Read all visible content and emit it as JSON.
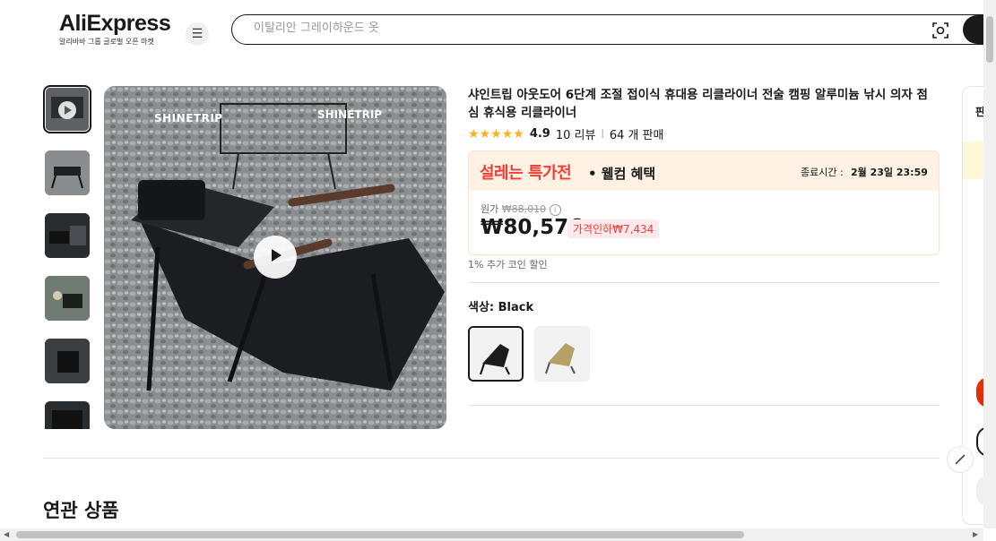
{
  "header": {
    "logo": "AliExpress",
    "logo_sub": "알리바바 그룹 글로벌 오픈 마켓",
    "search_placeholder": "이탈리안 그레이하운드 옷"
  },
  "gallery": {
    "thumbnail_count": 6,
    "brand_left": "SHINETRIP",
    "brand_right": "SHINETRIP"
  },
  "product": {
    "title": "샤인트립 아웃도어 6단계 조절 접이식 휴대용 리클라이너 전술 캠핑 알루미늄 낚시 의자 점심 휴식용 리클라이너",
    "rating": "4.9",
    "reviews": "10 리뷰",
    "sold": "64 개 판매",
    "stars": 5
  },
  "sale": {
    "brand": "설레는 특가전",
    "sub": "• 웰컴 혜택",
    "end_label": "종료시간 :",
    "end_time": "2월 23일 23:59",
    "orig_label": "원가",
    "orig_price": "₩88,010",
    "price": "₩80,576",
    "discount": "가격인하₩7,434",
    "coin_note": "1% 추가 코인 할인"
  },
  "color": {
    "label": "색상: Black",
    "swatches": [
      "Black",
      "Khaki"
    ]
  },
  "related": {
    "title": "연관 상품"
  },
  "right_panel": {
    "label": "판"
  },
  "colors": {
    "accent_red": "#f23d32",
    "star": "#fdb21c",
    "sale_bg": "#fff1e4"
  }
}
